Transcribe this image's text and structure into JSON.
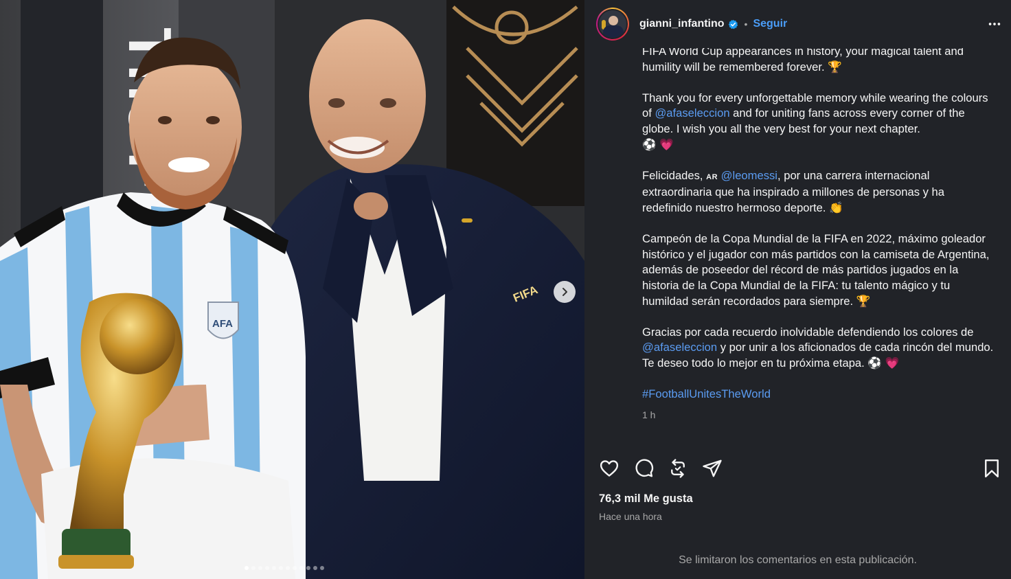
{
  "post": {
    "username": "gianni_infantino",
    "separator": "•",
    "follow_label": "Seguir",
    "verified_icon": "verified-badge-icon",
    "more_icon": "more-options-icon"
  },
  "media": {
    "description_icons": [
      "heart",
      "comment",
      "repost",
      "share",
      "bookmark"
    ],
    "carousel_count": 12,
    "carousel_active_index": 0,
    "next_icon": "chevron-right-icon",
    "photo_text": {
      "wall_text": "The F",
      "badge": "AFA",
      "suit_logo": "FIFA"
    }
  },
  "caption": {
    "p1_line1": "FIFA World Cup appearances in history, your magical talent and",
    "p1_line2": "humility will be remembered forever.",
    "p1_emoji": "🏆",
    "p2_text_a": "Thank you for every unforgettable memory while wearing the colours of ",
    "p2_mention": "@afaseleccion",
    "p2_text_b": " and for uniting fans across every corner of the globe. I wish you all the very best for your next chapter.",
    "p2_emoji": "⚽ 💗",
    "p3_text_a": "Felicidades, ",
    "p3_flag": "AR",
    "p3_mention": "@leomessi",
    "p3_text_b": ", por una carrera internacional extraordinaria que ha inspirado a millones de personas y ha redefinido nuestro hermoso deporte.",
    "p3_emoji": "👏",
    "p4_text": "Campeón de la Copa Mundial de la FIFA en 2022, máximo goleador histórico y el jugador con más partidos con la camiseta de Argentina, además de poseedor del récord de más partidos jugados en la historia de la Copa Mundial de la FIFA: tu talento mágico y tu humildad serán recordados para siempre.",
    "p4_emoji": "🏆",
    "p5_text_a": "Gracias por cada recuerdo inolvidable defendiendo los colores de ",
    "p5_mention": "@afaseleccion",
    "p5_text_b": " y por unir a los aficionados de cada rincón del mundo. Te deseo todo lo mejor en tu próxima etapa.",
    "p5_emoji": "⚽ 💗",
    "hashtag": "#FootballUnitesTheWorld",
    "time": "1 h"
  },
  "footer": {
    "likes": "76,3 mil Me gusta",
    "ago": "Hace una hora",
    "comments_limited": "Se limitaron los comentarios en esta publicación."
  },
  "colors": {
    "panel_bg": "#212328",
    "link": "#5b9cf2",
    "follow": "#4a9df8",
    "muted": "#a8a8a8"
  }
}
